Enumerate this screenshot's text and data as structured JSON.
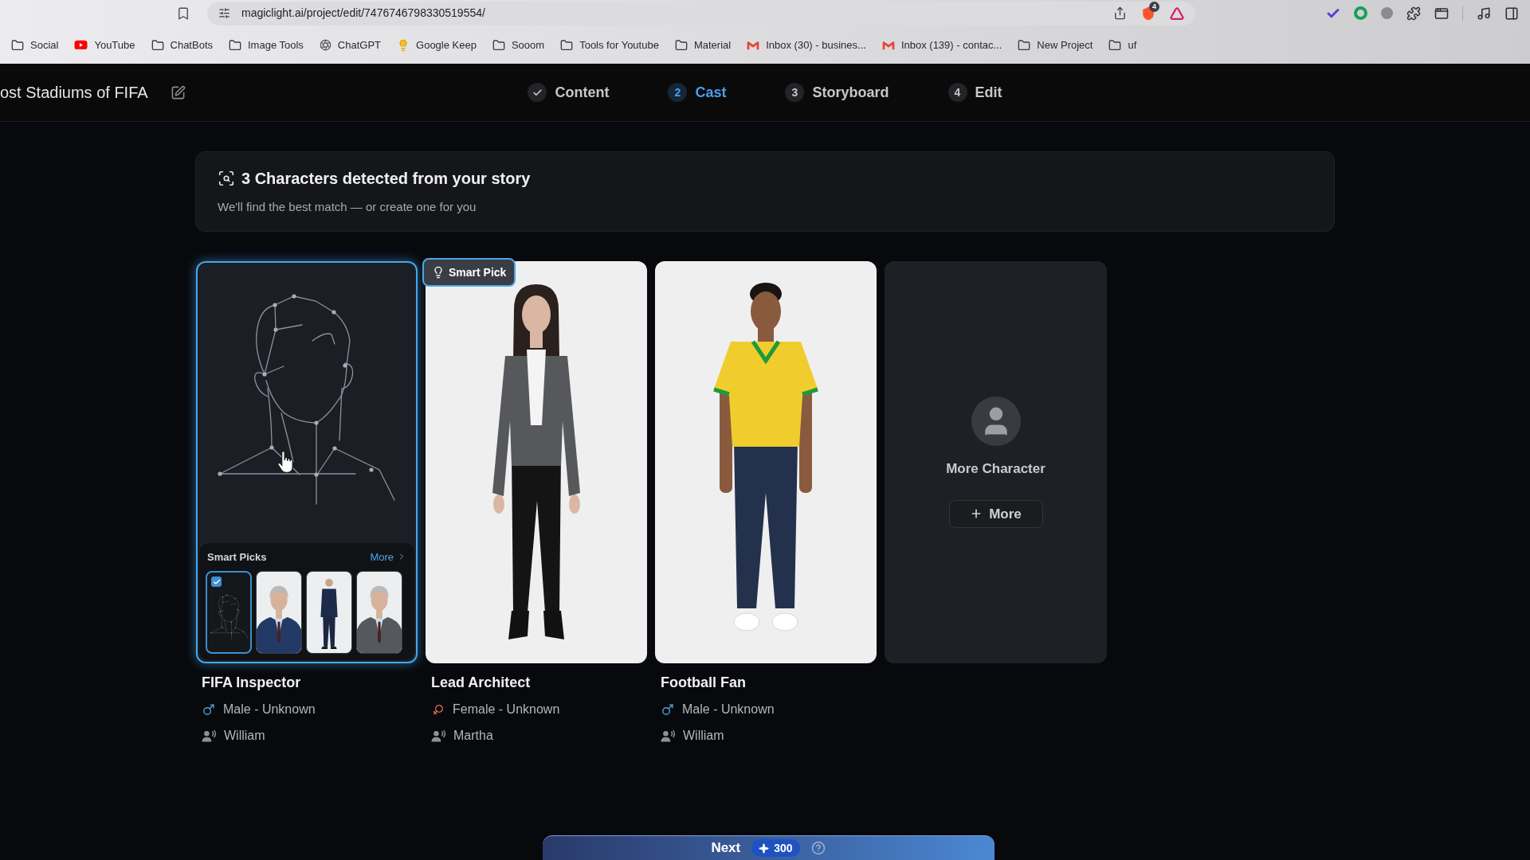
{
  "browser": {
    "url": "magiclight.ai/project/edit/7476746798330519554/",
    "shield_badge": "4",
    "bookmarks": [
      {
        "kind": "folder",
        "label": "Social"
      },
      {
        "kind": "video",
        "label": "YouTube"
      },
      {
        "kind": "folder",
        "label": "ChatBots"
      },
      {
        "kind": "folder",
        "label": "Image Tools"
      },
      {
        "kind": "web",
        "label": "ChatGPT"
      },
      {
        "kind": "note",
        "label": "Google Keep"
      },
      {
        "kind": "folder",
        "label": "Sooom"
      },
      {
        "kind": "folder",
        "label": "Tools for Youtube"
      },
      {
        "kind": "folder",
        "label": "Material"
      },
      {
        "kind": "mail",
        "label": "Inbox (30) - busines..."
      },
      {
        "kind": "mail",
        "label": "Inbox (139) - contac..."
      },
      {
        "kind": "folder",
        "label": "New Project"
      },
      {
        "kind": "folder",
        "label": "uf"
      }
    ]
  },
  "header": {
    "project_title": "ost Stadiums of FIFA"
  },
  "steps": [
    {
      "label": "Content",
      "done": true,
      "selected": false
    },
    {
      "number": "2",
      "label": "Cast",
      "done": false,
      "selected": true
    },
    {
      "number": "3",
      "label": "Storyboard",
      "done": false,
      "selected": false
    },
    {
      "number": "4",
      "label": "Edit",
      "done": false,
      "selected": false
    }
  ],
  "banner": {
    "title": "3 Characters detected from your story",
    "subtitle": "We'll find the best match — or create one for you"
  },
  "characters": [
    {
      "kind": "sketch",
      "selected": true,
      "name": "FIFA Inspector",
      "gender": {
        "kind": "male",
        "label": "Male - Unknown"
      },
      "voice": "William",
      "smart_picks": {
        "title": "Smart Picks",
        "more": "More",
        "items": [
          {
            "kind": "sketch",
            "selected": true
          },
          {
            "kind": "photo",
            "selected": false
          },
          {
            "kind": "photo",
            "selected": false
          },
          {
            "kind": "photo",
            "selected": false
          }
        ]
      }
    },
    {
      "kind": "photo",
      "selected": false,
      "badge": "Smart Pick",
      "name": "Lead Architect",
      "gender": {
        "kind": "female",
        "label": "Female - Unknown"
      },
      "voice": "Martha"
    },
    {
      "kind": "photo",
      "selected": false,
      "name": "Football Fan",
      "gender": {
        "kind": "male",
        "label": "Male - Unknown"
      },
      "voice": "William"
    }
  ],
  "more_card": {
    "label": "More Character",
    "button": "More"
  },
  "footer": {
    "button": "Next",
    "cost": "300"
  }
}
